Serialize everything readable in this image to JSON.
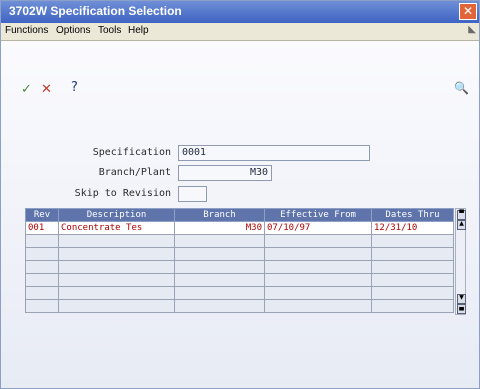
{
  "window": {
    "title": "3702W  Specification Selection"
  },
  "menu": {
    "items": [
      "Functions",
      "Options",
      "Tools",
      "Help"
    ]
  },
  "toolbar": {
    "ok": "✓",
    "cancel": "✕",
    "help": "?",
    "search": "🔍"
  },
  "form": {
    "spec_label": "Specification",
    "spec_value": "0001",
    "branch_label": "Branch/Plant",
    "branch_value": "M30",
    "skip_label": "Skip to Revision",
    "skip_value": ""
  },
  "grid": {
    "columns": [
      "Rev",
      "Description",
      "Branch",
      "Effective From",
      "Dates Thru"
    ],
    "rows": [
      [
        "001",
        "Concentrate Tes",
        "M30",
        "07/10/97",
        "12/31/10"
      ],
      [
        "",
        "",
        "",
        "",
        ""
      ],
      [
        "",
        "",
        "",
        "",
        ""
      ],
      [
        "",
        "",
        "",
        "",
        ""
      ],
      [
        "",
        "",
        "",
        "",
        ""
      ],
      [
        "",
        "",
        "",
        "",
        ""
      ],
      [
        "",
        "",
        "",
        "",
        ""
      ]
    ]
  },
  "colors": {
    "title_bar": "#3e63c3",
    "grid_header": "#5f74ab",
    "row_text": "#b00000"
  }
}
